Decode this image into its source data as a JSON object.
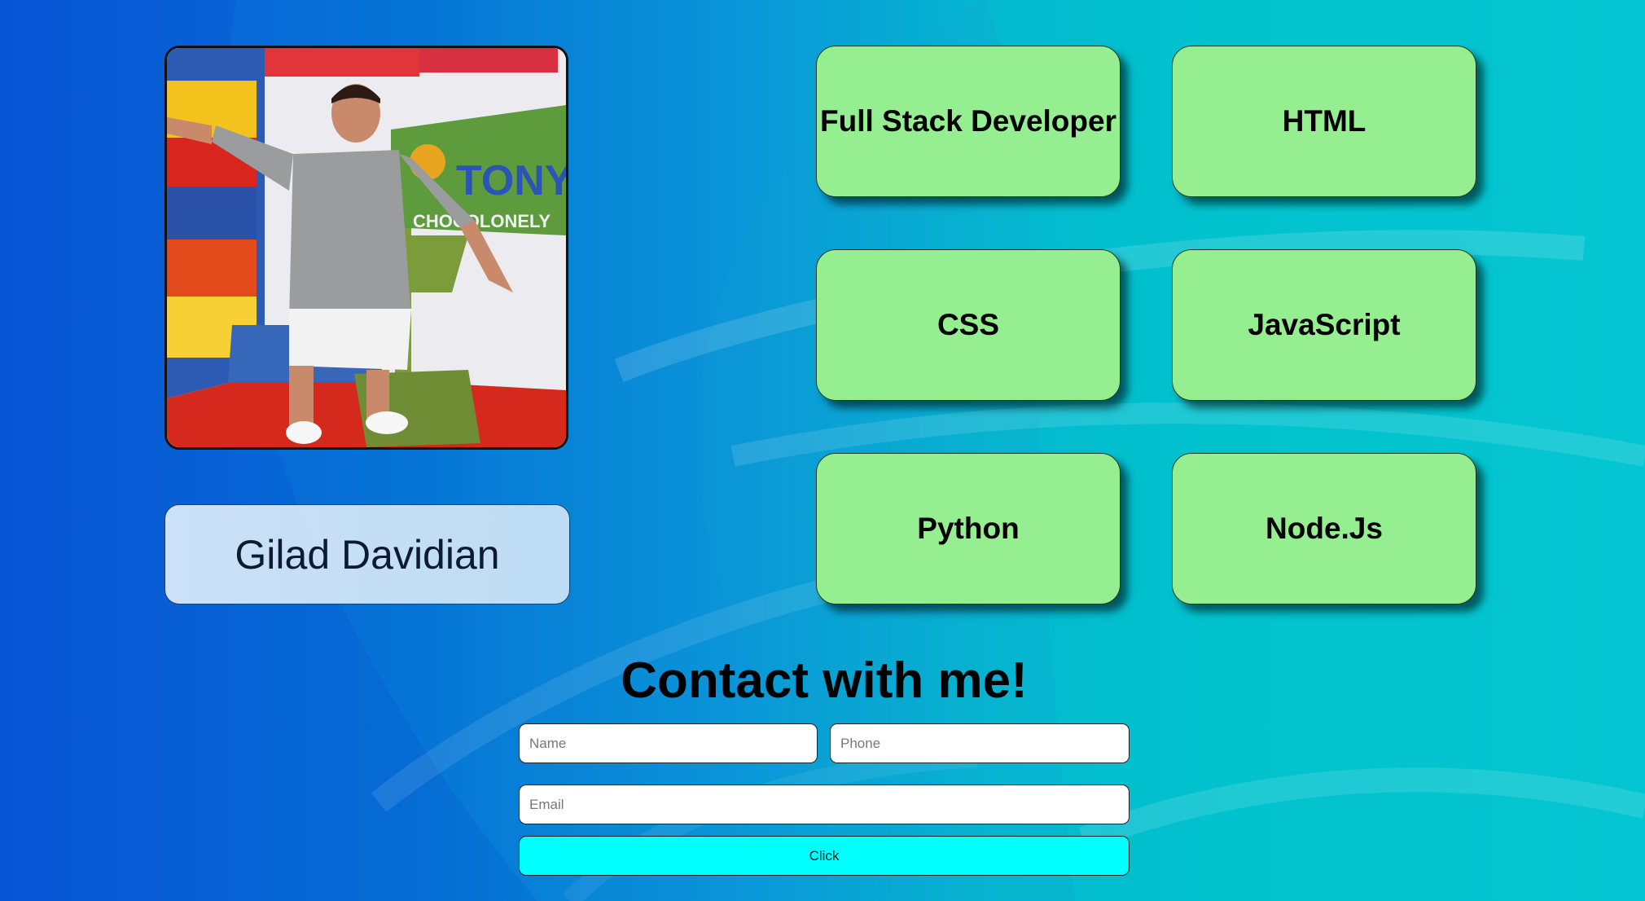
{
  "profile": {
    "name": "Gilad Davidian"
  },
  "photo": {
    "sign_text": "TONY'S",
    "sign_subtext": "CHOCOLONELY",
    "wall_text": "CHOCOLONELY"
  },
  "skills": [
    {
      "label": "Full Stack Developer"
    },
    {
      "label": "HTML"
    },
    {
      "label": "CSS"
    },
    {
      "label": "JavaScript"
    },
    {
      "label": "Python"
    },
    {
      "label": "Node.Js"
    }
  ],
  "contact": {
    "title": "Contact with me!",
    "name_placeholder": "Name",
    "phone_placeholder": "Phone",
    "email_placeholder": "Email",
    "submit_label": "Click"
  },
  "colors": {
    "skill_card": "#95ee90",
    "submit_button": "#00ffff"
  }
}
